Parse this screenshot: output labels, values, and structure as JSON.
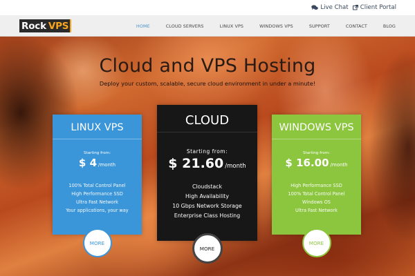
{
  "topbar": {
    "live_chat": "Live Chat",
    "client_portal": "Client Portal"
  },
  "logo": {
    "part1": "Rock",
    "part2": "VPS"
  },
  "nav": {
    "items": [
      {
        "label": "HOME",
        "active": true
      },
      {
        "label": "CLOUD SERVERS",
        "active": false
      },
      {
        "label": "LINUX VPS",
        "active": false
      },
      {
        "label": "WINDOWS VPS",
        "active": false
      },
      {
        "label": "SUPPORT",
        "active": false
      },
      {
        "label": "CONTACT",
        "active": false
      },
      {
        "label": "BLOG",
        "active": false
      }
    ]
  },
  "hero": {
    "title": "Cloud and VPS Hosting",
    "subtitle": "Deploy your custom, scalable, secure cloud environment in under a minute!"
  },
  "plans": [
    {
      "name": "LINUX VPS",
      "from": "Starting from:",
      "price": "$ 4",
      "period": "/month",
      "features": [
        "100% Total Control Panel",
        "High Performance SSD",
        "Ultra Fast Network",
        "Your applications, your way"
      ],
      "button": "MORE",
      "color": "#3a95d9"
    },
    {
      "name": "CLOUD",
      "from": "Starting from:",
      "price": "$ 21.60",
      "period": "/month",
      "features": [
        "Cloudstack",
        "High Availability",
        "10 Gbps Network Storage",
        "Enterprise Class Hosting"
      ],
      "button": "MORE",
      "color": "#171717"
    },
    {
      "name": "WINDOWS VPS",
      "from": "Starting from:",
      "price": "$ 16.00",
      "period": "/month",
      "features": [
        "High Performance SSD",
        "100% Total Control Panel",
        "Windows OS",
        "Ultra Fast Network"
      ],
      "button": "MORE",
      "color": "#8cc63f"
    }
  ],
  "colors": {
    "accent_blue": "#3a95d9",
    "accent_green": "#8cc63f",
    "logo_orange": "#f7a51c",
    "nav_active": "#4a90c8"
  },
  "icons": {
    "live_chat": "chat-bubbles-icon",
    "client_portal": "external-link-icon"
  }
}
